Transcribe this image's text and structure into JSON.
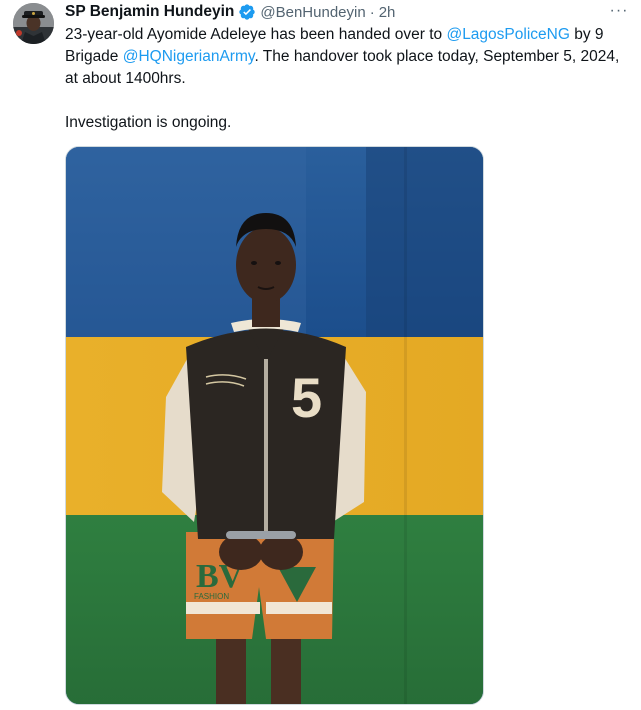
{
  "author": {
    "display_name": "SP Benjamin Hundeyin",
    "handle": "@BenHundeyin",
    "separator": "·",
    "time": "2h",
    "verified_icon": "verified-badge-icon",
    "avatar_icon": "avatar-police-officer"
  },
  "menu": {
    "icon": "more-options-icon",
    "glyph": "···"
  },
  "tweet": {
    "line1_text": "23-year-old Ayomide Adeleye has been handed over to ",
    "mention1": "@LagosPoliceNG",
    "line2_text": " by 9 Brigade ",
    "mention2": "@HQNigerianArmy",
    "line2_tail": ". The handover took place today, September 5, 2024, at about 1400hrs.",
    "paragraph2": "Investigation is ongoing."
  },
  "media": {
    "type": "photo",
    "jacket_number": "5",
    "shorts_text": "BV",
    "shorts_sub": "FASHION"
  },
  "colors": {
    "link": "#1d9bf0",
    "secondary_text": "#536471",
    "verified": "#1d9bf0",
    "wall_blue": "#1f5a9e",
    "wall_yellow": "#e8b32a",
    "wall_green": "#2e7d3e"
  }
}
